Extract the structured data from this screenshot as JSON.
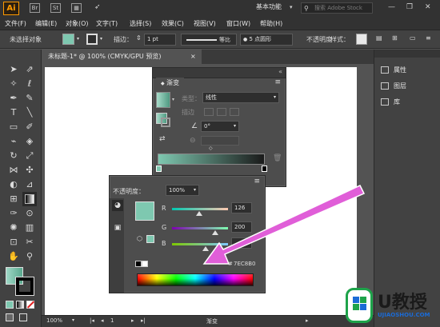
{
  "app": {
    "logo": "Ai",
    "br_label": "Br",
    "st_label": "St",
    "workspace": "基本功能",
    "search_placeholder": "搜索 Adobe Stock"
  },
  "menu": [
    "文件(F)",
    "编辑(E)",
    "对象(O)",
    "文字(T)",
    "选择(S)",
    "效果(C)",
    "视图(V)",
    "窗口(W)",
    "帮助(H)"
  ],
  "control": {
    "selection": "未选择对象",
    "stroke_label": "描边：",
    "stroke_value": "1 pt",
    "stroke_profile": "等比",
    "brush_value": "5 点圆形",
    "opacity_label": "不透明度",
    "style_label": "样式："
  },
  "document": {
    "tab": "未标题-1* @ 100% (CMYK/GPU 预览)",
    "close": "×"
  },
  "status": {
    "zoom": "100%",
    "page": "1",
    "tool_name": "渐变"
  },
  "dock": {
    "items": [
      "属性",
      "图层",
      "库"
    ]
  },
  "gradient_panel": {
    "tab": "渐变",
    "type_label": "类型：",
    "type_value": "线性",
    "stroke_label": "描边",
    "angle_value": "0°"
  },
  "color_panel": {
    "opacity_label": "不透明度：",
    "opacity_value": "100%",
    "r_label": "R",
    "g_label": "G",
    "b_label": "B",
    "r_value": "126",
    "g_value": "200",
    "b_value": "",
    "hex_label": "#",
    "hex_value": "7EC8B0"
  },
  "watermark": {
    "brand": "U教授",
    "url": "UJIAOSHOU.COM"
  },
  "colors": {
    "swatch": "#7ec8b0",
    "arrow": "#e05ed8",
    "brand_green": "#1ea34a",
    "brand_blue": "#1b6bd6"
  },
  "icons": [
    "search-icon",
    "close-icon",
    "minimize-icon",
    "maximize-icon",
    "selection-tool-icon",
    "pen-tool-icon",
    "type-tool-icon",
    "gradient-tool-icon",
    "hand-tool-icon",
    "zoom-tool-icon",
    "properties-icon",
    "layers-icon",
    "libraries-icon",
    "arrow-icon"
  ]
}
